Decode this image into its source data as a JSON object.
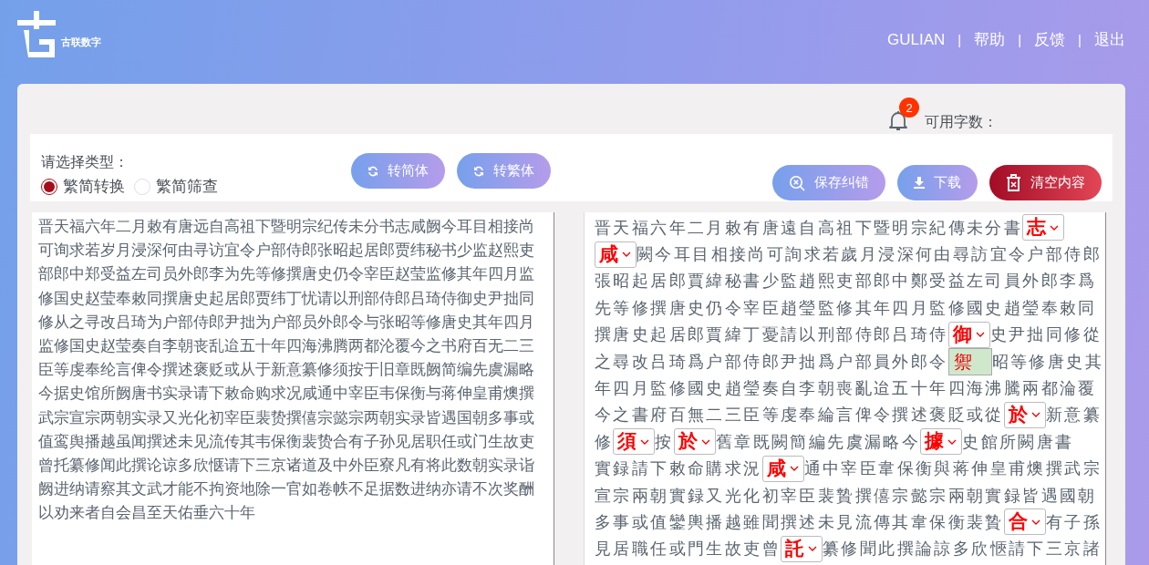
{
  "header": {
    "logo_text": "古联数字",
    "nav": [
      {
        "kind": "link",
        "label": "GULIAN"
      },
      {
        "kind": "separator",
        "label": "|"
      },
      {
        "kind": "link",
        "label": "帮助"
      },
      {
        "kind": "separator",
        "label": "|"
      },
      {
        "kind": "link",
        "label": "反馈"
      },
      {
        "kind": "separator",
        "label": "|"
      },
      {
        "kind": "link",
        "label": "退出"
      }
    ]
  },
  "status": {
    "notification_count": "2",
    "quota_label": "可用字数："
  },
  "toolbar": {
    "type_label": "请选择类型：",
    "modes": [
      {
        "label": "繁简转换",
        "selected": true
      },
      {
        "label": "繁简筛查",
        "selected": false
      }
    ],
    "convert_buttons": [
      {
        "label": "转简体"
      },
      {
        "label": "转繁体"
      }
    ],
    "actions": [
      {
        "kind": "save",
        "label": "保存纠错"
      },
      {
        "kind": "download",
        "label": "下载"
      },
      {
        "kind": "clear",
        "label": "清空内容"
      }
    ]
  },
  "source_lines": [
    "晋天福六年二月敕有唐远自高祖下暨明宗纪传未分书志咸阙今耳目相接尚",
    "可询求若岁月浸深何由寻访宜令户部侍郎张昭起居郎贾纬秘书少监赵熙吏",
    "部郎中郑受益左司员外郎李为先等修撰唐史仍令宰臣赵莹监修其年四月监",
    "修国史赵莹奉敕同撰唐史起居郎贾纬丁忧请以刑部侍郎吕琦侍御史尹拙同",
    "修从之寻改吕琦为户部侍郎尹拙为户部员外郎令与张昭等修唐史其年四月",
    "监修国史赵莹奏自李朝丧乱迨五十年四海沸腾两都沦覆今之书府百无二三",
    "臣等虔奉纶言俾令撰述褒贬或从于新意纂修须按于旧章既阙简编先虞漏略",
    "今据史馆所阙唐书实录请下敕命购求况咸通中宰臣韦保衡与蒋伸皇甫燠撰",
    "武宗宣宗两朝实录又光化初宰臣裴贽撰僖宗懿宗两朝实录皆遇国朝多事或",
    "值鸾舆播越虽闻撰述未见流传其韦保衡裴贽合有子孙见居职任或门生故吏",
    "曾托纂修闻此撰论谅多欣惬请下三京诸道及中外臣寮凡有将此数朝实录诣",
    "阙进纳请察其文武才能不拘资地除一官如卷帙不足据数进纳亦请不次奖酬",
    "以劝来者自会昌至天佑垂六十年"
  ],
  "result_lines": [
    [
      {
        "kind": "text",
        "text": "晋天福六年二月敕有唐遠自高祖下暨明宗紀傳未分書"
      },
      {
        "kind": "correction",
        "text": "志"
      }
    ],
    [
      {
        "kind": "correction",
        "text": "咸"
      },
      {
        "kind": "text",
        "text": "闕今耳目相接尚可詢求若歲月浸深何由尋訪宜令户部侍郎"
      }
    ],
    [
      {
        "kind": "text",
        "text": "張昭起居郎賈緯秘書少監趙熙吏部郎中鄭受益左司員外郎李爲"
      }
    ],
    [
      {
        "kind": "text",
        "text": "先等修撰唐史仍令宰臣趙瑩監修其年四月監修國史趙瑩奉敕同"
      }
    ],
    [
      {
        "kind": "text",
        "text": "撰唐史起居郎賈緯丁憂請以刑部侍郎吕琦侍"
      },
      {
        "kind": "correction",
        "text": "御",
        "options": [
          "禦"
        ]
      },
      {
        "kind": "text",
        "text": "史尹拙同修從"
      }
    ],
    [
      {
        "kind": "text",
        "text": "之尋改吕琦爲户部侍郎尹拙爲户部員外郎令"
      },
      {
        "kind": "covered"
      },
      {
        "kind": "text",
        "text": "昭等修唐史其"
      }
    ],
    [
      {
        "kind": "text",
        "text": "年四月監修國史趙瑩奏自李朝喪亂迨五十年四海沸騰兩都淪覆"
      }
    ],
    [
      {
        "kind": "text",
        "text": "今之書府百無二三臣等虔奉綸言俾令撰述褒貶或從"
      },
      {
        "kind": "correction",
        "text": "於"
      },
      {
        "kind": "text",
        "text": "新意纂"
      }
    ],
    [
      {
        "kind": "text",
        "text": "修"
      },
      {
        "kind": "correction",
        "text": "須"
      },
      {
        "kind": "text",
        "text": "按"
      },
      {
        "kind": "correction",
        "text": "於"
      },
      {
        "kind": "text",
        "text": "舊章既闕簡編先虞漏略今"
      },
      {
        "kind": "correction",
        "text": "據"
      },
      {
        "kind": "text",
        "text": "史館所闕唐書"
      }
    ],
    [
      {
        "kind": "text",
        "text": "實録請下敕命購求況"
      },
      {
        "kind": "correction",
        "text": "咸"
      },
      {
        "kind": "text",
        "text": "通中宰臣韋保衡與蒋伸皇甫燠撰武宗"
      }
    ],
    [
      {
        "kind": "text",
        "text": "宣宗兩朝實録又光化初宰臣裴贄撰僖宗懿宗兩朝實録皆遇國朝"
      }
    ],
    [
      {
        "kind": "text",
        "text": "多事或值鑾輿播越雖聞撰述未見流傳其韋保衡裴贄"
      },
      {
        "kind": "correction",
        "text": "合"
      },
      {
        "kind": "text",
        "text": "有子孫"
      }
    ],
    [
      {
        "kind": "text",
        "text": "見居職任或門生故吏曾"
      },
      {
        "kind": "correction",
        "text": "託"
      },
      {
        "kind": "text",
        "text": "纂修聞此撰論諒多欣愜請下三京諸"
      }
    ]
  ]
}
